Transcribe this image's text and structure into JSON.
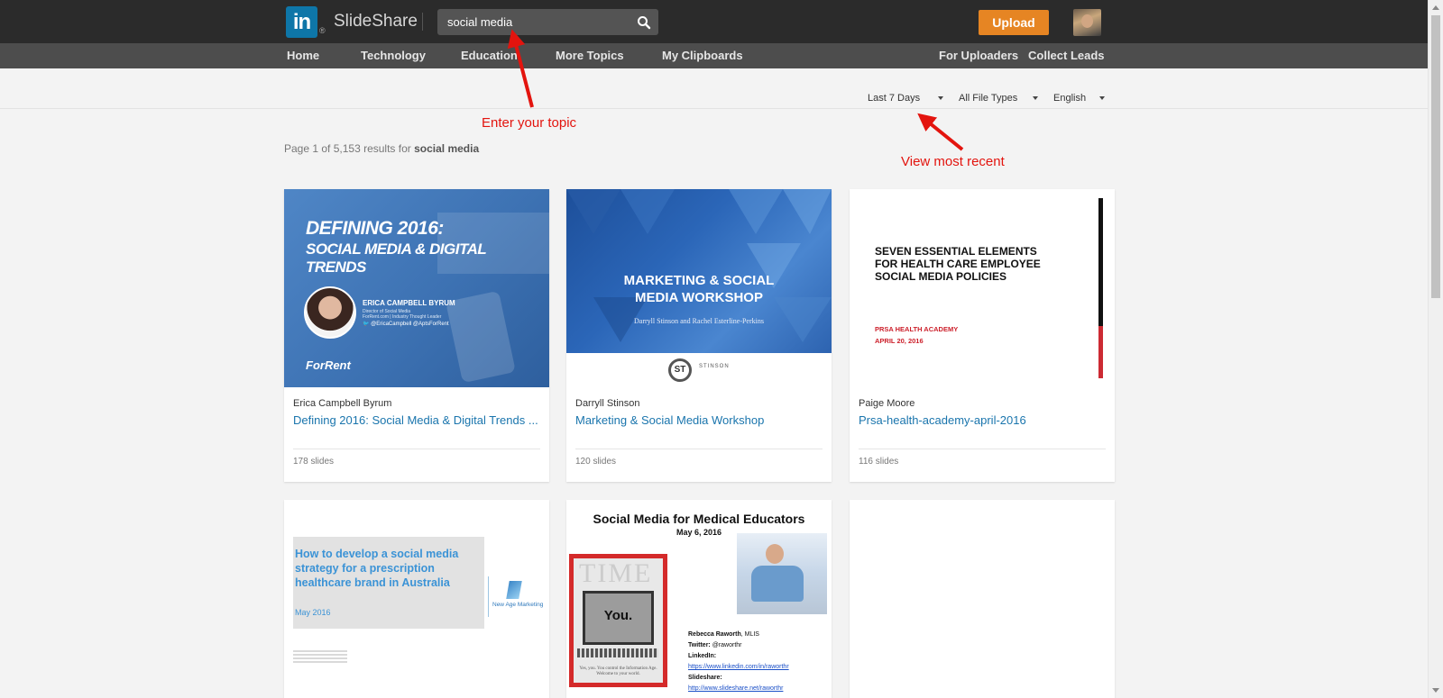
{
  "header": {
    "brand": "SlideShare",
    "logo_text": "in",
    "search": {
      "value": "social media",
      "icon": "search-icon"
    },
    "upload_label": "Upload"
  },
  "nav": {
    "left": [
      "Home",
      "Technology",
      "Education",
      "More Topics",
      "My Clipboards"
    ],
    "right": [
      "For Uploaders",
      "Collect Leads"
    ]
  },
  "filters": {
    "date": "Last 7 Days",
    "file_type": "All File Types",
    "language": "English"
  },
  "results": {
    "prefix": "Page 1 of 5,153 results for",
    "query": "social media"
  },
  "annotations": {
    "topic": "Enter your topic",
    "recent": "View most recent",
    "color": "#e3140e"
  },
  "cards": [
    {
      "author": "Erica Campbell Byrum",
      "title": "Defining 2016: Social Media & Digital Trends ...",
      "slides": "178 slides",
      "thumb": {
        "heading1": "DEFINING 2016:",
        "heading2": "SOCIAL MEDIA & DIGITAL TRENDS",
        "name": "ERICA CAMPBELL BYRUM",
        "role1": "Director of Social Media",
        "role2": "ForRent.com | Industry Thought Leader",
        "twitter": "@EricaCampbell @AptsForRent",
        "logo": "ForRent"
      }
    },
    {
      "author": "Darryll Stinson",
      "title": "Marketing & Social Media Workshop",
      "slides": "120 slides",
      "thumb": {
        "heading1": "MARKETING & SOCIAL",
        "heading2": "MEDIA WORKSHOP",
        "byline": "Darryll Stinson and Rachel Esterline-Perkins",
        "logo_mark": "ST",
        "logo_text": "STINSON"
      }
    },
    {
      "author": "Paige Moore",
      "title": "Prsa-health-academy-april-2016",
      "slides": "116 slides",
      "thumb": {
        "line1": "SEVEN ESSENTIAL ELEMENTS",
        "line2": "FOR HEALTH CARE EMPLOYEE",
        "line3": "SOCIAL MEDIA POLICIES",
        "sub1": "PRSA HEALTH ACADEMY",
        "sub2": "APRIL 20, 2016"
      }
    },
    {
      "thumb": {
        "heading": "How to develop a social media strategy for a prescription healthcare brand in Australia",
        "date": "May 2016",
        "logo_text": "New Age Marketing"
      }
    },
    {
      "thumb": {
        "heading": "Social Media for Medical Educators",
        "date": "May 6, 2016",
        "magazine": "TIME",
        "you": "You.",
        "tagline": "Yes, you. You control the Information Age. Welcome to your world.",
        "name": "Rebecca Raworth",
        "cred": ", MLIS",
        "twitter_label": "Twitter:",
        "twitter": " @raworthr",
        "linkedin_label": "LinkedIn:",
        "linkedin": "https://www.linkedin.com/in/raworthr",
        "slideshare_label": "Slideshare:",
        "slideshare": "http://www.slideshare.net/raworthr"
      }
    },
    {}
  ]
}
